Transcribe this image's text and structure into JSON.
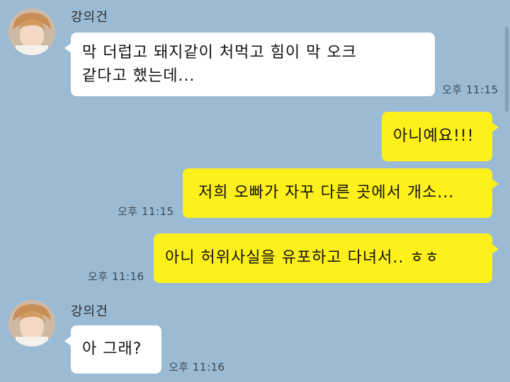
{
  "sender": {
    "name": "강의건"
  },
  "messages": [
    {
      "direction": "in",
      "text_line1": "막 더럽고 돼지같이 처먹고 힘이 막 오크",
      "text_line2": "같다고 했는데...",
      "time": "오후 11:15"
    },
    {
      "direction": "out",
      "text": "아니예요!!!"
    },
    {
      "direction": "out",
      "text": "저희 오빠가 자꾸 다른 곳에서 개소...",
      "time": "오후 11:15"
    },
    {
      "direction": "out",
      "text": "아니 허위사실을 유포하고 다녀서.. ㅎㅎ",
      "time": "오후 11:16"
    },
    {
      "direction": "in",
      "text": "아 그래?",
      "time": "오후 11:16"
    }
  ],
  "colors": {
    "background": "#9bbbd4",
    "incoming_bubble": "#ffffff",
    "outgoing_bubble": "#fef01b"
  },
  "icons": {
    "avatar": "profile-photo"
  }
}
